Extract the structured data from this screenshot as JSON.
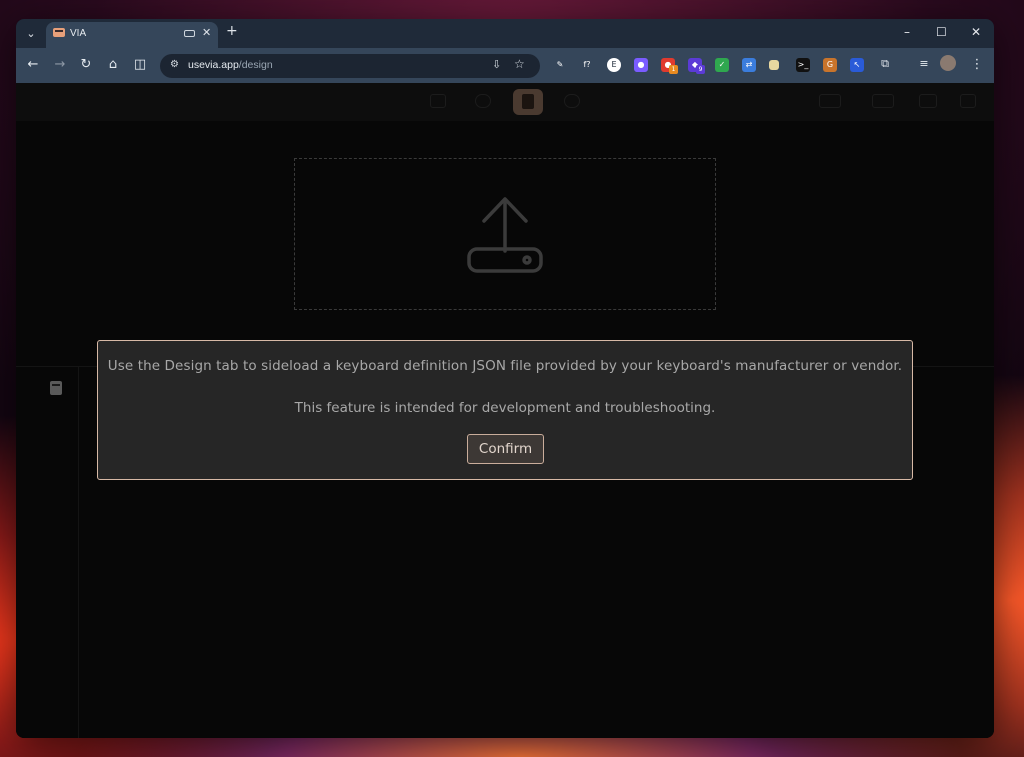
{
  "browser": {
    "tab": {
      "title": "VIA",
      "favicon": "keyboard-favicon",
      "close": "✕"
    },
    "new_tab": "+",
    "window_controls": {
      "minimize": "–",
      "maximize": "☐",
      "close": "✕"
    },
    "tab_search": "⌄",
    "nav": {
      "back": "←",
      "forward": "→",
      "reload": "↻",
      "home": "⌂",
      "reading": "◫"
    },
    "url": {
      "host": "usevia.app",
      "path": "/design"
    },
    "extensions": [
      {
        "name": "eyedropper-extension",
        "glyph": "✎",
        "color": "#35465a"
      },
      {
        "name": "font-extension",
        "glyph": "f?",
        "color": "#35465a"
      },
      {
        "name": "circle-e-extension",
        "glyph": "E",
        "color": "#ffffff"
      },
      {
        "name": "drop-extension",
        "glyph": "●",
        "color": "#7a5cff"
      },
      {
        "name": "red-extension",
        "glyph": "●",
        "color": "#e03a2e",
        "badge": "1"
      },
      {
        "name": "purple-extension",
        "glyph": "◆",
        "color": "#5b3bd6",
        "badge": "9"
      },
      {
        "name": "shield-extension",
        "glyph": "✓",
        "color": "#2fa84f"
      },
      {
        "name": "link-extension",
        "glyph": "⇄",
        "color": "#3b7ddd"
      },
      {
        "name": "note-extension",
        "glyph": "",
        "color": "#e8d8a0"
      },
      {
        "name": "terminal-extension",
        "glyph": ">_",
        "color": "#111111"
      },
      {
        "name": "g-extension",
        "glyph": "G",
        "color": "#c9742b"
      },
      {
        "name": "cursor-extension",
        "glyph": "↖",
        "color": "#2a5bd8"
      }
    ]
  },
  "modal": {
    "message_line1": "Use the Design tab to sideload a keyboard definition JSON file provided by your keyboard's manufacturer or vendor.",
    "message_line2": "This feature is intended for development and troubleshooting.",
    "confirm_label": "Confirm"
  },
  "colors": {
    "accent": "#d7b9a6",
    "modal_bg": "#262626",
    "app_bg": "#070707"
  }
}
